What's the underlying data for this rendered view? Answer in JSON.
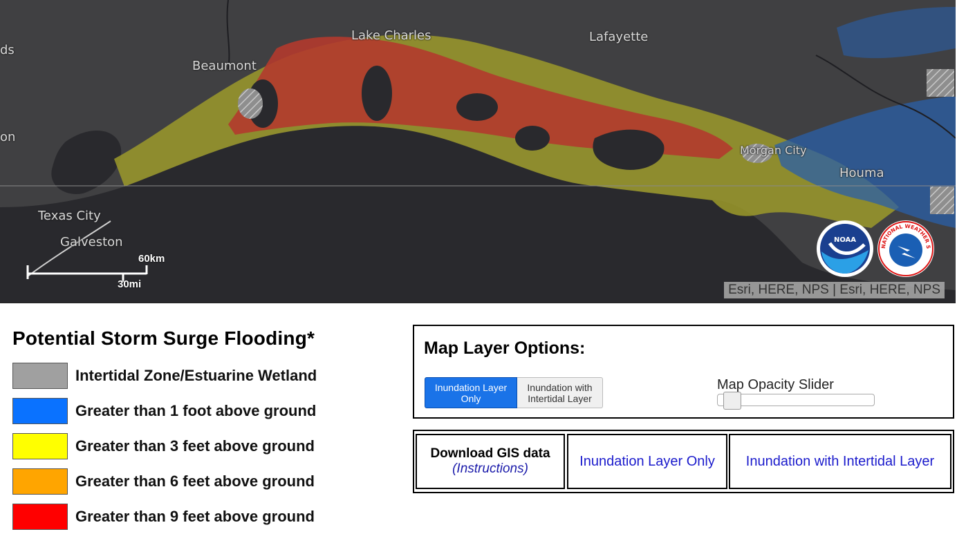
{
  "map": {
    "places": [
      {
        "name": "ds",
        "key": "ds"
      },
      {
        "name": "Beaumont",
        "key": "beaumont"
      },
      {
        "name": "Lake Charles",
        "key": "lake-charles"
      },
      {
        "name": "Lafayette",
        "key": "lafayette"
      },
      {
        "name": "on",
        "key": "on"
      },
      {
        "name": "Morgan City",
        "key": "morgan-city"
      },
      {
        "name": "Houma",
        "key": "houma"
      },
      {
        "name": "Texas City",
        "key": "texas-city"
      },
      {
        "name": "Galveston",
        "key": "galveston"
      }
    ],
    "scale_km": "60km",
    "scale_mi": "30mi",
    "attribution": "Esri, HERE, NPS | Esri, HERE, NPS",
    "noaa_text": "NOAA",
    "nws_text": "NATIONAL WEATHER SERVICE"
  },
  "legend": {
    "title": "Potential Storm Surge Flooding*",
    "items": [
      {
        "label": "Intertidal Zone/Estuarine Wetland",
        "color": "#a0a0a0"
      },
      {
        "label": "Greater than 1 foot above ground",
        "color": "#0a72ff"
      },
      {
        "label": "Greater than 3 feet above ground",
        "color": "#ffff00"
      },
      {
        "label": "Greater than 6 feet above ground",
        "color": "#ffa500"
      },
      {
        "label": "Greater than 9 feet above ground",
        "color": "#ff0000"
      }
    ]
  },
  "layer_options": {
    "title": "Map Layer Options:",
    "btn_inundation_only": "Inundation Layer Only",
    "btn_with_intertidal": "Inundation with Intertidal Layer",
    "opacity_label": "Map Opacity Slider",
    "opacity_value": 0.02
  },
  "download": {
    "title": "Download GIS data",
    "instructions": "(Instructions)",
    "link_inundation_only": "Inundation Layer Only",
    "link_with_intertidal": "Inundation with Intertidal Layer"
  }
}
